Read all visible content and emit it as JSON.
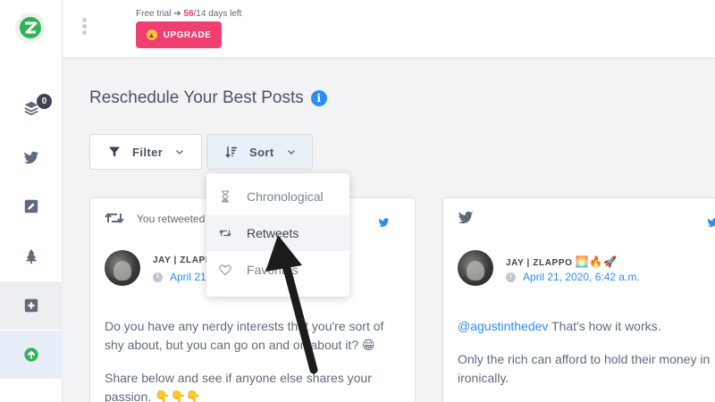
{
  "topbar": {
    "trial_prefix": "Free trial ➔ ",
    "trial_used": "56",
    "trial_suffix": "/14 days left",
    "upgrade_label": "UPGRADE"
  },
  "sidebar": {
    "queue_badge": "0",
    "items": [
      {
        "name": "queue",
        "icon": "layers-icon"
      },
      {
        "name": "twitter",
        "icon": "twitter-icon"
      },
      {
        "name": "compose",
        "icon": "edit-icon"
      },
      {
        "name": "evergreen",
        "icon": "tree-icon"
      },
      {
        "name": "add",
        "icon": "plus-square-icon"
      },
      {
        "name": "upload",
        "icon": "arrow-up-circle-icon"
      }
    ]
  },
  "page": {
    "title": "Reschedule Your Best Posts"
  },
  "controls": {
    "filter_label": "Filter",
    "sort_label": "Sort"
  },
  "sort_menu": {
    "items": [
      {
        "label": "Chronological",
        "icon": "hourglass-icon"
      },
      {
        "label": "Retweets",
        "icon": "retweet-icon"
      },
      {
        "label": "Favorites",
        "icon": "heart-icon"
      }
    ]
  },
  "cards": [
    {
      "header": "You retweeted",
      "author": "JAY | ZLAPPO",
      "date": "April 21",
      "paragraph1": "Do you have any nerdy interests that you're sort of shy about, but you can go on and on about it? 😁",
      "paragraph2": "Share below and see if anyone else shares your passion. 👇👇👇"
    },
    {
      "author": "JAY | ZLAPPO",
      "author_emoji": "🌅🔥🚀",
      "date": "April 21, 2020, 6:42 a.m.",
      "mention": "@agustinthedev",
      "paragraph1_rest": " That's how it works.",
      "paragraph2": "Only the rich can afford to hold their money in ironically."
    }
  ],
  "colors": {
    "accent_pink": "#ef3e6f",
    "link_blue": "#2b8ff0",
    "sidebar_active_green": "#2fb457"
  }
}
